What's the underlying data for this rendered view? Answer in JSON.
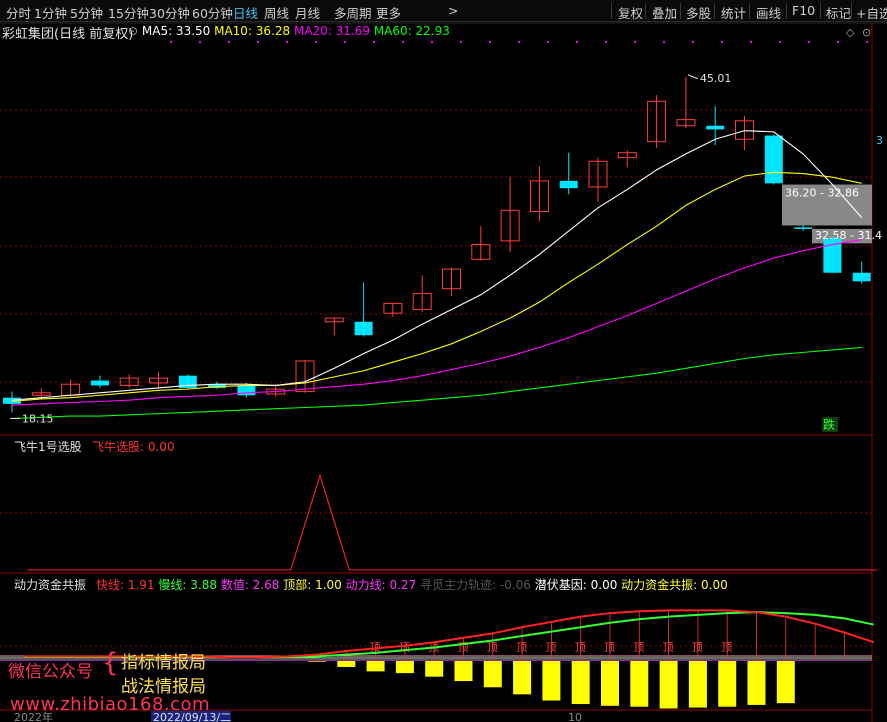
{
  "toolbar": {
    "periods": [
      "分时",
      "1分钟",
      "5分钟",
      "15分钟",
      "30分钟",
      "60分钟",
      "日线",
      "周线",
      "月线",
      "多周期",
      "更多"
    ],
    "active": "日线",
    "more_arrow": ">",
    "tools": [
      "复权",
      "叠加",
      "多股",
      "统计",
      "画线",
      "F10",
      "标记",
      "+自选"
    ]
  },
  "header": {
    "stock_name": "彩虹集团(日线 前复权)",
    "ma_items": [
      {
        "label": "MA5: 33.50",
        "color": "#ffffff"
      },
      {
        "label": "MA10: 36.28",
        "color": "#ffff00"
      },
      {
        "label": "MA20: 31.69",
        "color": "#ff00ff"
      },
      {
        "label": "MA60: 22.93",
        "color": "#00ff00"
      }
    ],
    "right_icons": [
      "diamond-icon",
      "gear-icon"
    ]
  },
  "colors": {
    "up": "#ff3d3d",
    "down": "#00e5ff",
    "ma5": "#ffffff",
    "ma10": "#ffff00",
    "ma20": "#ff00ff",
    "ma60": "#00ff00",
    "grid": "#8b0000"
  },
  "chart_data": [
    {
      "type": "candlestick",
      "panel": "main",
      "ylim": [
        16,
        48
      ],
      "x": [
        1,
        2,
        3,
        4,
        5,
        6,
        7,
        8,
        9,
        10,
        11,
        12,
        13,
        14,
        15,
        16,
        17,
        18,
        19,
        20,
        21,
        22,
        23,
        24,
        25,
        26,
        27,
        28,
        29
      ],
      "series": [
        {
          "name": "candles",
          "values": [
            {
              "o": 18.8,
              "h": 19.3,
              "l": 17.6,
              "c": 18.3
            },
            {
              "o": 19.0,
              "h": 19.6,
              "l": 18.8,
              "c": 19.2
            },
            {
              "o": 19.0,
              "h": 20.3,
              "l": 18.9,
              "c": 19.9
            },
            {
              "o": 20.2,
              "h": 20.6,
              "l": 19.6,
              "c": 19.8
            },
            {
              "o": 19.8,
              "h": 20.7,
              "l": 19.6,
              "c": 20.4
            },
            {
              "o": 20.0,
              "h": 20.9,
              "l": 19.6,
              "c": 20.4
            },
            {
              "o": 20.6,
              "h": 20.7,
              "l": 19.5,
              "c": 19.6
            },
            {
              "o": 19.9,
              "h": 20.1,
              "l": 19.5,
              "c": 19.6
            },
            {
              "o": 19.8,
              "h": 20.0,
              "l": 18.8,
              "c": 19.0
            },
            {
              "o": 19.1,
              "h": 19.9,
              "l": 18.9,
              "c": 19.5
            },
            {
              "o": 19.3,
              "h": 21.9,
              "l": 19.2,
              "c": 21.8
            },
            {
              "o": 25.0,
              "h": 25.3,
              "l": 23.9,
              "c": 25.3
            },
            {
              "o": 25.0,
              "h": 28.2,
              "l": 23.8,
              "c": 23.9
            },
            {
              "o": 25.7,
              "h": 26.5,
              "l": 25.4,
              "c": 26.5
            },
            {
              "o": 26.0,
              "h": 28.8,
              "l": 25.8,
              "c": 27.3
            },
            {
              "o": 27.7,
              "h": 29.4,
              "l": 27.1,
              "c": 29.3
            },
            {
              "o": 30.1,
              "h": 32.8,
              "l": 30.0,
              "c": 31.3
            },
            {
              "o": 31.6,
              "h": 36.8,
              "l": 30.7,
              "c": 34.1
            },
            {
              "o": 34.0,
              "h": 37.7,
              "l": 33.2,
              "c": 36.5
            },
            {
              "o": 36.5,
              "h": 38.8,
              "l": 35.4,
              "c": 35.9
            },
            {
              "o": 36.0,
              "h": 38.4,
              "l": 34.8,
              "c": 38.1
            },
            {
              "o": 38.4,
              "h": 39.0,
              "l": 37.6,
              "c": 38.8
            },
            {
              "o": 39.7,
              "h": 43.5,
              "l": 39.2,
              "c": 43.0
            },
            {
              "o": 41.0,
              "h": 45.0,
              "l": 40.8,
              "c": 41.5
            },
            {
              "o": 41.0,
              "h": 42.6,
              "l": 39.4,
              "c": 40.7
            },
            {
              "o": 39.9,
              "h": 41.8,
              "l": 39.0,
              "c": 41.4
            },
            {
              "o": 40.2,
              "h": 40.3,
              "l": 36.2,
              "c": 36.3
            },
            {
              "o": 32.7,
              "h": 32.9,
              "l": 32.4,
              "c": 32.6
            },
            {
              "o": 31.8,
              "h": 32.0,
              "l": 29.0,
              "c": 29.0
            },
            {
              "o": 29.0,
              "h": 29.9,
              "l": 28.1,
              "c": 28.3
            }
          ]
        },
        {
          "name": "MA5",
          "values": [
            18.6,
            18.8,
            19.0,
            19.2,
            19.4,
            19.6,
            19.8,
            19.9,
            19.9,
            19.8,
            20.1,
            21.2,
            22.4,
            23.5,
            24.8,
            26.0,
            27.2,
            28.8,
            30.5,
            32.4,
            34.3,
            35.8,
            37.4,
            38.7,
            39.9,
            40.6,
            40.5,
            38.7,
            36.2,
            33.5
          ]
        },
        {
          "name": "MA10",
          "values": [
            18.5,
            18.7,
            18.8,
            19.0,
            19.2,
            19.4,
            19.5,
            19.7,
            19.8,
            19.8,
            20.0,
            20.5,
            21.0,
            21.7,
            22.4,
            23.2,
            24.2,
            25.3,
            26.6,
            28.2,
            29.7,
            31.3,
            32.8,
            34.5,
            35.8,
            36.9,
            37.2,
            37.1,
            36.8,
            36.3
          ]
        },
        {
          "name": "MA20",
          "values": [
            18.2,
            18.3,
            18.4,
            18.5,
            18.6,
            18.8,
            18.9,
            19.0,
            19.2,
            19.3,
            19.5,
            19.7,
            19.9,
            20.2,
            20.6,
            21.1,
            21.6,
            22.2,
            22.9,
            23.7,
            24.6,
            25.5,
            26.5,
            27.5,
            28.5,
            29.4,
            30.2,
            30.8,
            31.3,
            31.7
          ]
        },
        {
          "name": "MA60",
          "values": [
            17.1,
            17.2,
            17.3,
            17.3,
            17.4,
            17.5,
            17.6,
            17.7,
            17.8,
            17.9,
            18.0,
            18.1,
            18.2,
            18.4,
            18.6,
            18.8,
            19.0,
            19.3,
            19.6,
            19.9,
            20.2,
            20.5,
            20.8,
            21.2,
            21.6,
            22.0,
            22.3,
            22.5,
            22.7,
            22.9
          ]
        }
      ],
      "annotations": [
        {
          "text": "45.01",
          "type": "high"
        },
        {
          "text": "18.15",
          "type": "low"
        },
        {
          "text": "36.20 - 32.86",
          "type": "gap"
        },
        {
          "text": "32.58 - 31.4",
          "type": "gap"
        },
        {
          "text": "跌",
          "type": "signal"
        }
      ],
      "right_price": "3"
    },
    {
      "type": "line",
      "panel": "feiniu",
      "title": "飞牛1号选股",
      "series_label": "飞牛选股: 0.00",
      "x": [
        1,
        2,
        3,
        4,
        5,
        6,
        7,
        8,
        9,
        10,
        11,
        12,
        13,
        14,
        15,
        16,
        17,
        18,
        19,
        20,
        21,
        22,
        23,
        24,
        25,
        26,
        27,
        28,
        29,
        30
      ],
      "series": [
        {
          "name": "飞牛选股",
          "values": [
            0,
            0,
            0,
            0,
            0,
            0,
            0,
            0,
            0,
            0,
            1,
            0,
            0,
            0,
            0,
            0,
            0,
            0,
            0,
            0,
            0,
            0,
            0,
            0,
            0,
            0,
            0,
            0,
            0,
            0
          ]
        }
      ],
      "ylim": [
        0,
        1.1
      ]
    },
    {
      "type": "line",
      "panel": "dongli",
      "title": "动力资金共振",
      "labels": [
        {
          "text": "快线: 1.91",
          "color": "#ff3333"
        },
        {
          "text": "慢线: 3.88",
          "color": "#33ff33"
        },
        {
          "text": "数值: 2.68",
          "color": "#ff33ff"
        },
        {
          "text": "顶部: 1.00",
          "color": "#ffff33"
        },
        {
          "text": "动力线: 0.27",
          "color": "#ff33ff"
        },
        {
          "text": "寻觅主力轨迹: -0.06",
          "color": "#555555"
        },
        {
          "text": "潜伏基因: 0.00",
          "color": "#ffffff"
        },
        {
          "text": "动力资金共振: 0.00",
          "color": "#ffff33"
        }
      ],
      "ylim": [
        -6,
        6
      ],
      "x": [
        1,
        2,
        3,
        4,
        5,
        6,
        7,
        8,
        9,
        10,
        11,
        12,
        13,
        14,
        15,
        16,
        17,
        18,
        19,
        20,
        21,
        22,
        23,
        24,
        25,
        26,
        27,
        28,
        29,
        30
      ],
      "series": [
        {
          "name": "快线",
          "values": [
            0.3,
            0.3,
            0.3,
            0.3,
            0.3,
            0.3,
            0.3,
            0.2,
            0.2,
            0.3,
            0.5,
            0.9,
            1.2,
            1.5,
            1.9,
            2.4,
            2.9,
            3.6,
            4.2,
            4.8,
            5.2,
            5.4,
            5.5,
            5.5,
            5.5,
            5.3,
            4.8,
            4.0,
            3.0,
            1.9
          ]
        },
        {
          "name": "慢线",
          "values": [
            0.2,
            0.2,
            0.2,
            0.2,
            0.2,
            0.2,
            0.2,
            0.2,
            0.2,
            0.2,
            0.3,
            0.5,
            0.7,
            1.0,
            1.3,
            1.7,
            2.1,
            2.6,
            3.1,
            3.6,
            4.1,
            4.5,
            4.8,
            5.0,
            5.2,
            5.3,
            5.2,
            5.0,
            4.6,
            3.9
          ]
        },
        {
          "name": "柱",
          "values": [
            0,
            0,
            0,
            0,
            0,
            0,
            0,
            0,
            0,
            0,
            -0.3,
            -0.9,
            -1.4,
            -1.6,
            -2.0,
            -2.5,
            -3.2,
            -4.0,
            -4.7,
            -5.1,
            -5.3,
            -5.4,
            -5.6,
            -5.5,
            -5.4,
            -5.2,
            -5.0,
            0,
            0,
            0
          ]
        }
      ],
      "bar_tops": [
        "顶",
        "顶",
        "顶",
        "顶",
        "顶",
        "顶",
        "顶",
        "顶",
        "顶",
        "顶",
        "顶",
        "顶",
        "顶"
      ]
    }
  ],
  "xaxis": {
    "labels": [
      "2022年",
      "2022/09/13/二",
      "10"
    ]
  },
  "watermark": {
    "line1": "微信公众号",
    "line2a": "指标情报局",
    "line2b": "战法情报局",
    "url": "www.zhibiao168.com"
  }
}
